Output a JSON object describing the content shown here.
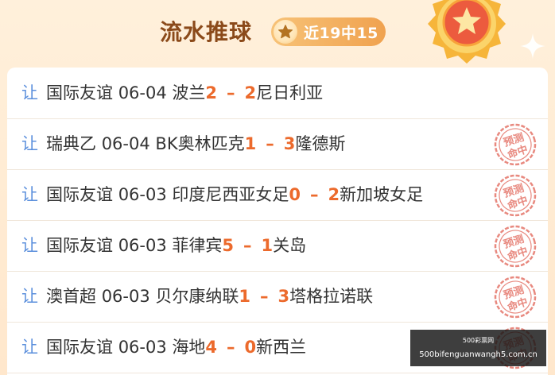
{
  "header": {
    "title": "流水推球",
    "badge_text": "近19中15",
    "star_icon": "star-icon",
    "medal_icon": "medal-icon"
  },
  "colors": {
    "title": "#8b4a1a",
    "badge_bg": "#f0a24f",
    "rang": "#5b8fdc",
    "score": "#ec6a2c",
    "stamp": "#e8897f"
  },
  "stamp_text": [
    "预测",
    "命中"
  ],
  "matches": [
    {
      "tag": "让",
      "league": "国际友谊",
      "date": "06-04",
      "home": "波兰",
      "home_score": "2",
      "sep": "–",
      "away_score": "2",
      "away": "尼日利亚",
      "hit": false
    },
    {
      "tag": "让",
      "league": "瑞典乙",
      "date": "06-04",
      "home": "BK奥林匹克",
      "home_score": "1",
      "sep": "–",
      "away_score": "3",
      "away": "隆德斯",
      "hit": true
    },
    {
      "tag": "让",
      "league": "国际友谊",
      "date": "06-03",
      "home": "印度尼西亚女足",
      "home_score": "0",
      "sep": "–",
      "away_score": "2",
      "away": "新加坡女足",
      "hit": true
    },
    {
      "tag": "让",
      "league": "国际友谊",
      "date": "06-03",
      "home": "菲律宾",
      "home_score": "5",
      "sep": "–",
      "away_score": "1",
      "away": "关岛",
      "hit": true
    },
    {
      "tag": "让",
      "league": "澳首超",
      "date": "06-03",
      "home": "贝尔康纳联",
      "home_score": "1",
      "sep": "–",
      "away_score": "3",
      "away": "塔格拉诺联",
      "hit": true
    },
    {
      "tag": "让",
      "league": "国际友谊",
      "date": "06-03",
      "home": "海地",
      "home_score": "4",
      "sep": "–",
      "away_score": "0",
      "away": "新西兰",
      "hit": true
    }
  ],
  "watermark": {
    "top": "500彩票网",
    "bottom": "500bifenguanwangh5.com.cn"
  }
}
